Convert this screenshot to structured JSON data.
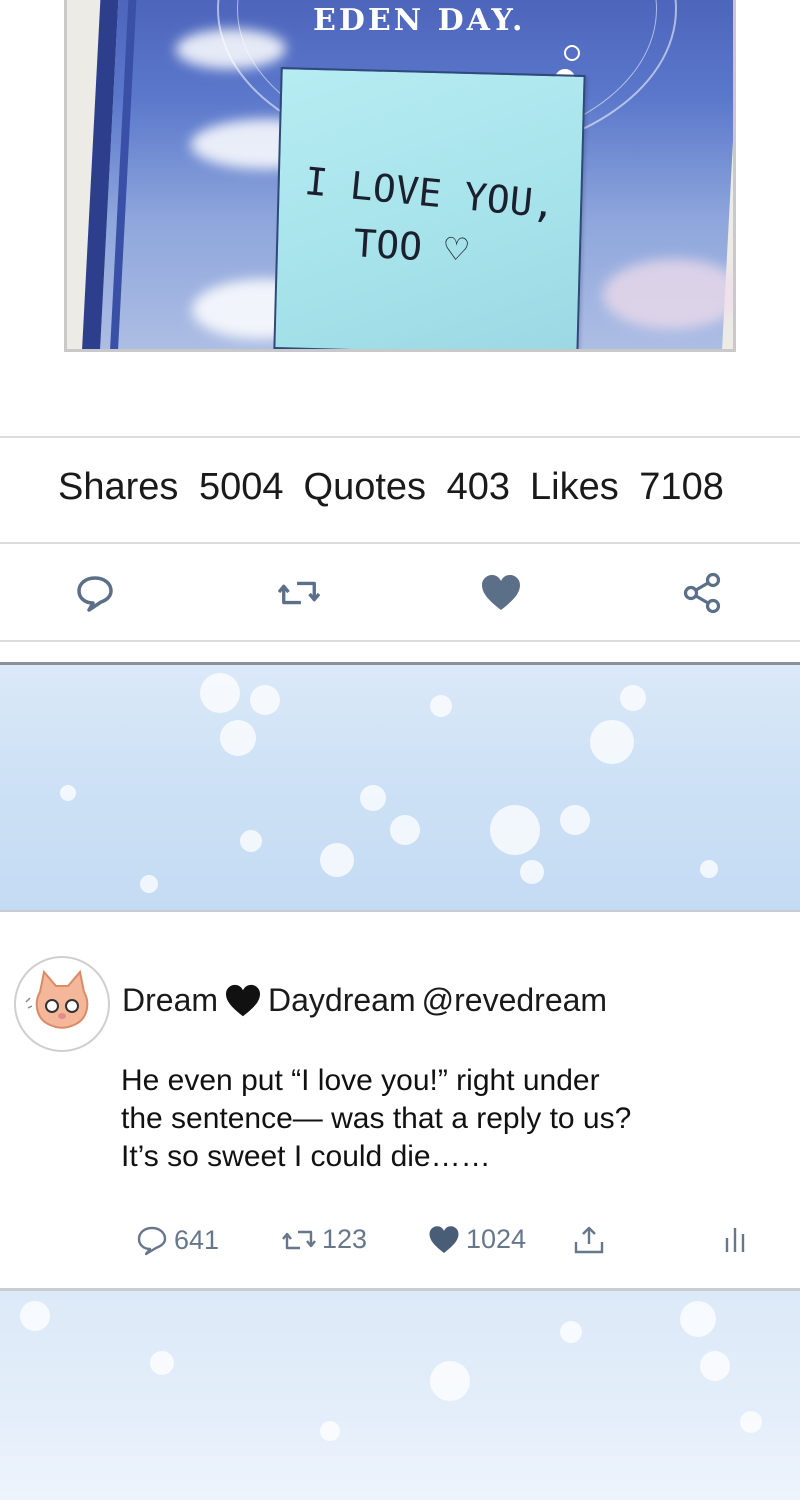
{
  "artwork": {
    "book_title": "EDEN DAY.",
    "note_line1": "I LOVE YOU,",
    "note_line2": "TOO ♡"
  },
  "stats": {
    "shares_label": "Shares",
    "shares_value": "5004",
    "quotes_label": "Quotes",
    "quotes_value": "403",
    "likes_label": "Likes",
    "likes_value": "7108"
  },
  "actions": {
    "icons": [
      "comment-icon",
      "retweet-icon",
      "heart-icon",
      "share-icon"
    ],
    "like_color": "#5b7088",
    "icon_color": "#66778a"
  },
  "tweet": {
    "display_name_part1": "Dream",
    "display_name_part2": "Daydream",
    "handle": "@revedream",
    "body_lines": [
      "He even put “I love you!” right under",
      "the sentence— was that a reply to us?",
      "It’s so sweet I could die……"
    ],
    "reply_count": "641",
    "retweet_count": "123",
    "like_count": "1024"
  }
}
